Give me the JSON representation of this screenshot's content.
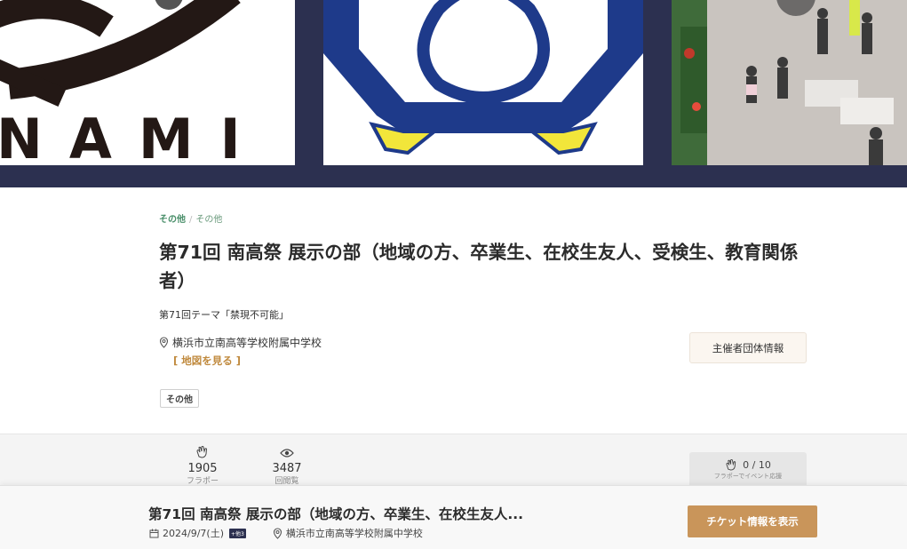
{
  "hero": {
    "logo_text": "NAMI",
    "colors": {
      "band": "#2c3050",
      "emblem_blue": "#1e3a8a",
      "emblem_yellow": "#f2e63a"
    }
  },
  "breadcrumb": {
    "parent": "その他",
    "current": "その他"
  },
  "event": {
    "title": "第71回 南高祭 展示の部（地域の方、卒業生、在校生友人、受検生、教育関係者）",
    "theme": "第71回テーマ「禁現不可能」",
    "location": "横浜市立南高等学校附属中学校",
    "map_link": "[ 地図を見る ]",
    "tag": "その他",
    "organizer_button": "主催者団体情報"
  },
  "stats": {
    "fans": {
      "value": "1905",
      "label": "フラポー"
    },
    "views": {
      "value": "3487",
      "label": "回閲覧"
    },
    "cheer": {
      "count": "0 / 10",
      "sub": "フラポーでイベント応援"
    }
  },
  "footer": {
    "title": "第71回 南高祭 展示の部（地域の方、卒業生、在校生友人...",
    "date": "2024/9/7(土)",
    "date_badge": "+他3",
    "location": "横浜市立南高等学校附属中学校",
    "ticket_button": "チケット情報を表示"
  },
  "accent": "#c9955a"
}
